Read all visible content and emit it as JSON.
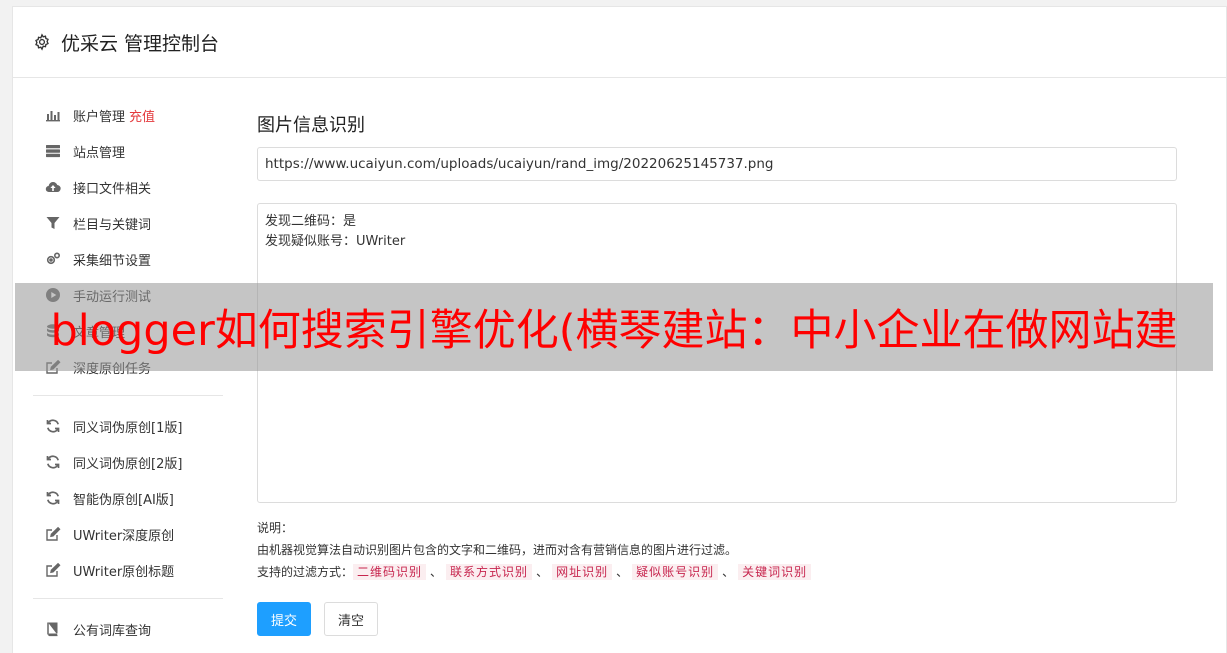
{
  "header": {
    "title": "优采云 管理控制台"
  },
  "sidebar": {
    "group1": [
      {
        "label": "账户管理",
        "extra": "充值",
        "icon": "bar-chart-icon"
      },
      {
        "label": "站点管理",
        "icon": "server-icon"
      },
      {
        "label": "接口文件相关",
        "icon": "cloud-upload-icon"
      },
      {
        "label": "栏目与关键词",
        "icon": "filter-icon"
      },
      {
        "label": "采集细节设置",
        "icon": "gears-icon"
      },
      {
        "label": "手动运行测试",
        "icon": "play-circle-icon"
      },
      {
        "label": "文章管理",
        "icon": "database-icon"
      },
      {
        "label": "深度原创任务",
        "icon": "edit-icon"
      }
    ],
    "group2": [
      {
        "label": "同义词伪原创[1版]",
        "icon": "refresh-icon"
      },
      {
        "label": "同义词伪原创[2版]",
        "icon": "refresh-icon"
      },
      {
        "label": "智能伪原创[AI版]",
        "icon": "refresh-icon"
      },
      {
        "label": "UWriter深度原创",
        "icon": "edit-icon"
      },
      {
        "label": "UWriter原创标题",
        "icon": "edit-icon"
      }
    ],
    "group3": [
      {
        "label": "公有词库查询",
        "icon": "book-icon"
      }
    ]
  },
  "main": {
    "title": "图片信息识别",
    "url_value": "https://www.ucaiyun.com/uploads/ucaiyun/rand_img/20220625145737.png",
    "result_lines": [
      "发现二维码：是",
      "发现疑似账号：UWriter"
    ],
    "notes_label": "说明：",
    "notes_desc": "由机器视觉算法自动识别图片包含的文字和二维码，进而对含有营销信息的图片进行过滤。",
    "filter_label": "支持的过滤方式：",
    "filters": [
      "二维码识别",
      "联系方式识别",
      "网址识别",
      "疑似账号识别",
      "关键词识别"
    ],
    "filter_sep": "、",
    "submit_label": "提交",
    "clear_label": "清空"
  },
  "overlay": {
    "text": "blogger如何搜索引擎优化(横琴建站：中小企业在做网站建"
  },
  "colors": {
    "accent": "#1e9fff",
    "red": "#e4393c",
    "tag_bg": "#fbeef0",
    "tag_text": "#c7254e"
  }
}
